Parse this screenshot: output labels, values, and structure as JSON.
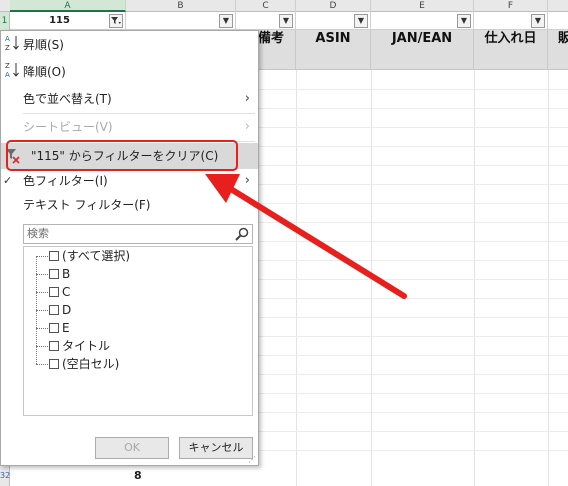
{
  "sheet": {
    "col_headers": [
      "A",
      "B",
      "C",
      "D",
      "E",
      "F"
    ],
    "row_header_1": "1",
    "active_cell_value": "115",
    "header_cells": [
      {
        "text": "備考"
      },
      {
        "text": "ASIN"
      },
      {
        "text": "JAN/EAN"
      },
      {
        "text": "仕入れ日"
      },
      {
        "text": "販"
      }
    ],
    "bottom_row_header": "32",
    "bottom_value": "8"
  },
  "menu": {
    "sort_asc": "昇順(S)",
    "sort_desc": "降順(O)",
    "sort_by_color": "色で並べ替え(T)",
    "sheet_view": "シートビュー(V)",
    "clear_filter": "\"115\" からフィルターをクリア(C)",
    "color_filter": "色フィルター(I)",
    "text_filter": "テキスト フィルター(F)",
    "submenu_arrow": "›",
    "checkmark": "✓"
  },
  "search": {
    "placeholder": "検索",
    "icon": "magnifier-icon"
  },
  "filter_list": [
    "(すべて選択)",
    "B",
    "C",
    "D",
    "E",
    "タイトル",
    "(空白セル)"
  ],
  "buttons": {
    "ok": "OK",
    "cancel": "キャンセル"
  },
  "colors": {
    "annotation_red": "#e8201d",
    "selected_header": "#217346",
    "header_band": "#dedede",
    "highlight": "#d9d9d9"
  }
}
